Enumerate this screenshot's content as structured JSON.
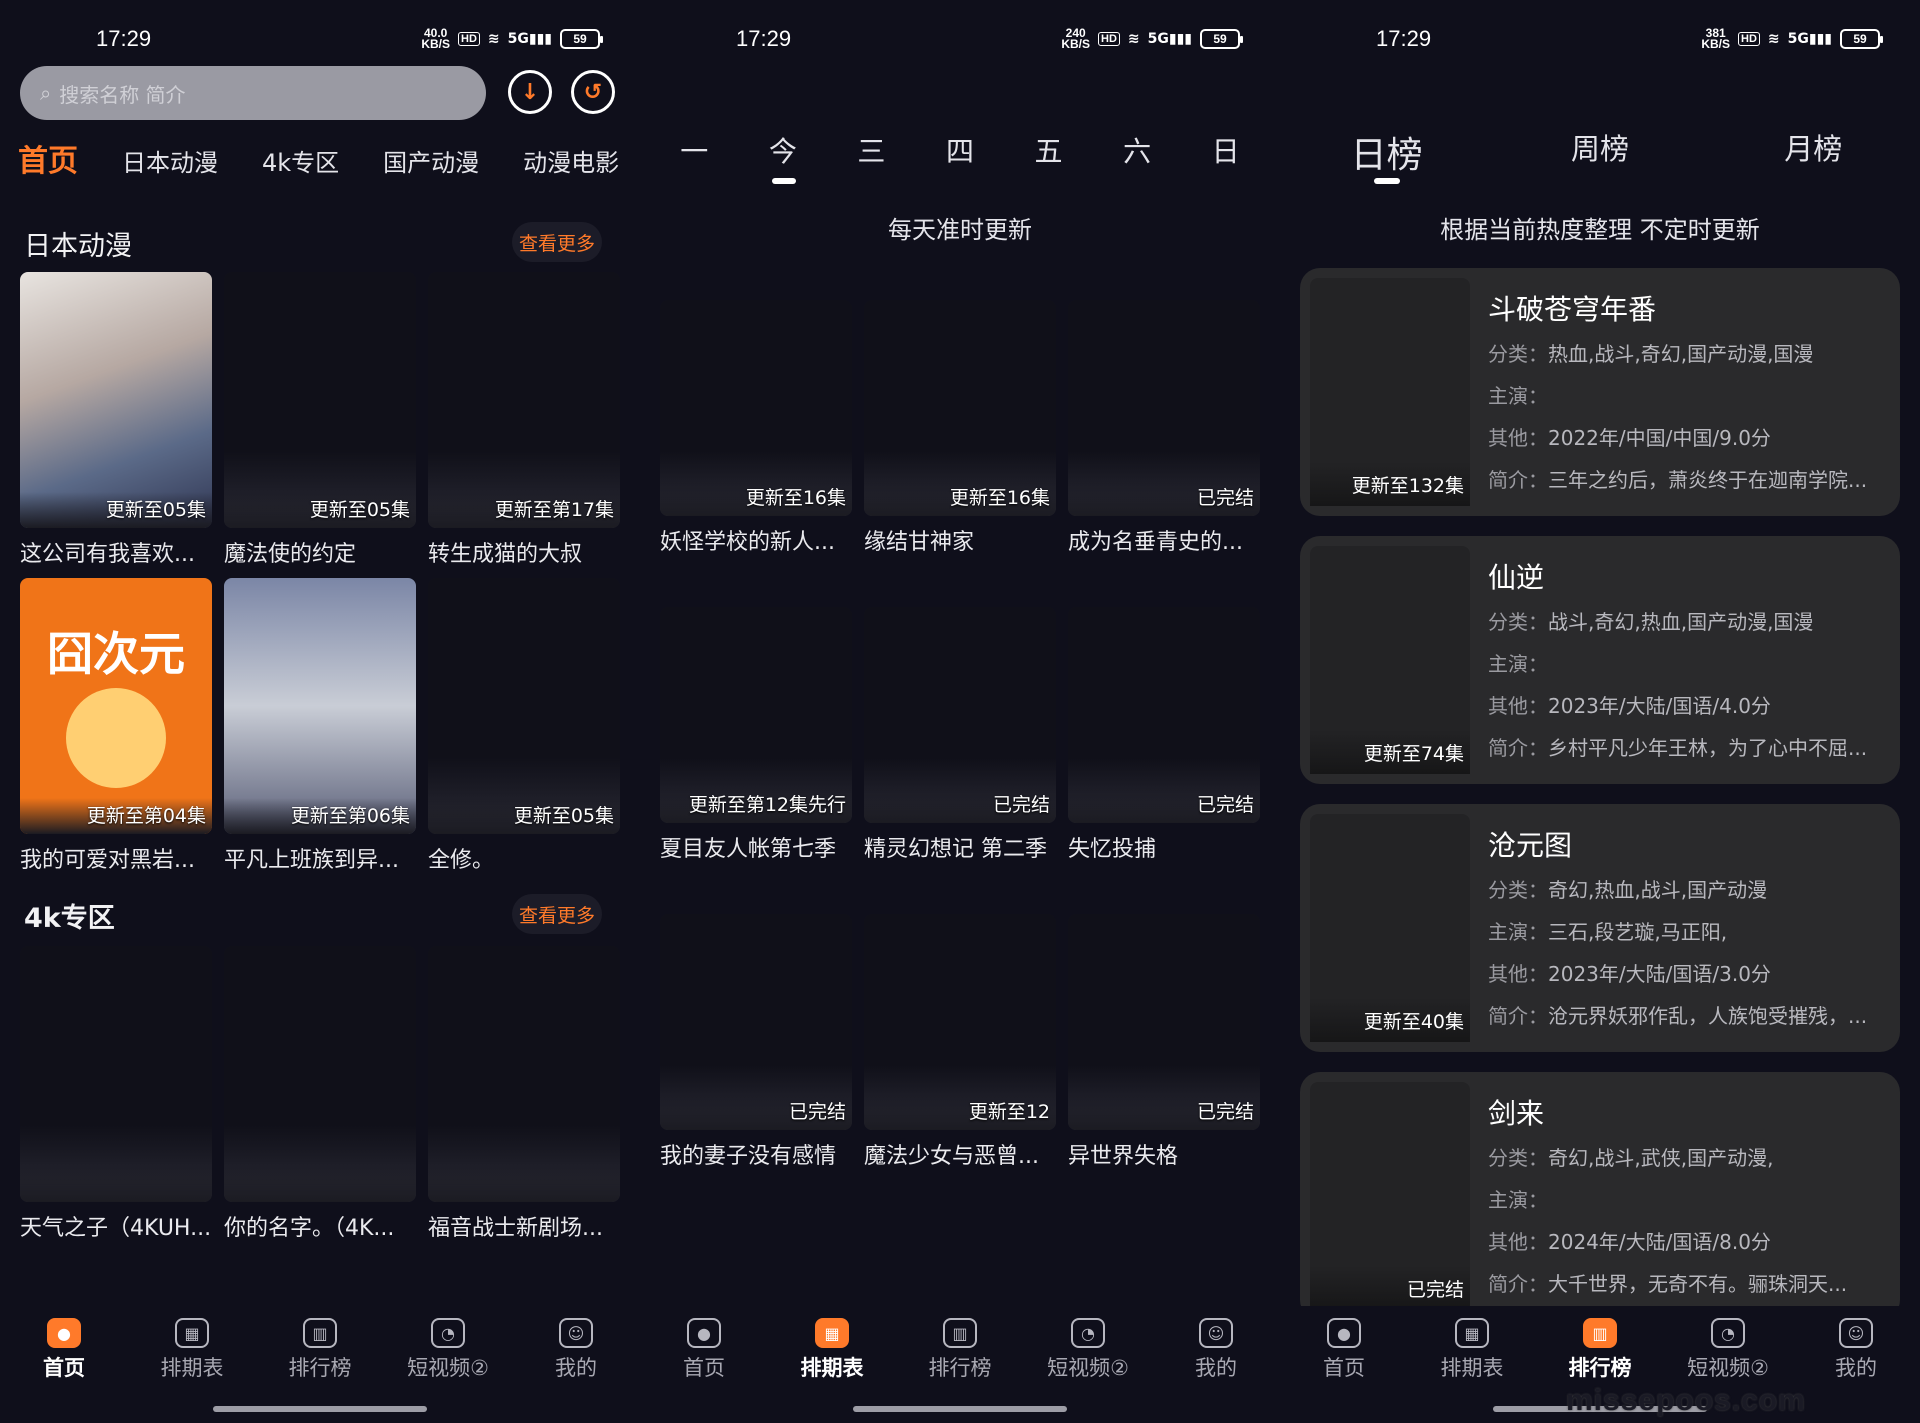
{
  "status": {
    "time": "17:29",
    "speeds": [
      "40.0",
      "240",
      "381"
    ],
    "speed_unit": "KB/S",
    "hd": "HD",
    "net": "5G",
    "battery": "59"
  },
  "home": {
    "search_placeholder": "搜索名称 简介",
    "tabs": [
      "首页",
      "日本动漫",
      "4k专区",
      "国产动漫",
      "动漫电影"
    ],
    "section1_title": "日本动漫",
    "section2_title": "4k专区",
    "more_label": "查看更多",
    "art_text": "囧次元",
    "jp_cards": [
      {
        "ep": "更新至05集",
        "title": "这公司有我喜欢..."
      },
      {
        "ep": "更新至05集",
        "title": "魔法使的约定"
      },
      {
        "ep": "更新至第17集",
        "title": "转生成猫的大叔"
      },
      {
        "ep": "更新至第04集",
        "title": "我的可爱对黑岩..."
      },
      {
        "ep": "更新至第06集",
        "title": "平凡上班族到异..."
      },
      {
        "ep": "更新至05集",
        "title": "全修。"
      }
    ],
    "k4_cards": [
      {
        "title": "天气之子（4KUH..."
      },
      {
        "title": "你的名字。（4K..."
      },
      {
        "title": "福音战士新剧场..."
      }
    ]
  },
  "schedule": {
    "days": [
      "一",
      "今",
      "三",
      "四",
      "五",
      "六",
      "日"
    ],
    "subtitle": "每天准时更新",
    "cards": [
      {
        "ep": "更新至16集",
        "title": "妖怪学校的新人..."
      },
      {
        "ep": "更新至16集",
        "title": "缘结甘神家"
      },
      {
        "ep": "已完结",
        "title": "成为名垂青史的..."
      },
      {
        "ep": "更新至第12集先行",
        "title": "夏目友人帐第七季"
      },
      {
        "ep": "已完结",
        "title": "精灵幻想记 第二季"
      },
      {
        "ep": "已完结",
        "title": "失忆投捕"
      },
      {
        "ep": "已完结",
        "title": "我的妻子没有感情"
      },
      {
        "ep": "更新至12",
        "title": "魔法少女与恶曾..."
      },
      {
        "ep": "已完结",
        "title": "异世界失格"
      }
    ]
  },
  "ranking": {
    "tabs": [
      "日榜",
      "周榜",
      "月榜"
    ],
    "subtitle": "根据当前热度整理 不定时更新",
    "labels": {
      "cat": "分类：",
      "cast": "主演：",
      "other": "其他：",
      "intro": "简介："
    },
    "items": [
      {
        "title": "斗破苍穹年番",
        "cat": "热血,战斗,奇幻,国产动漫,国漫",
        "cast": "",
        "other": "2022年/中国/中国/9.0分",
        "intro": "三年之约后，萧炎终于在迦南学院...",
        "ep": "更新至132集"
      },
      {
        "title": "仙逆",
        "cat": "战斗,奇幻,热血,国产动漫,国漫",
        "cast": "",
        "other": "2023年/大陆/国语/4.0分",
        "intro": "乡村平凡少年王林，为了心中不屈...",
        "ep": "更新至74集"
      },
      {
        "title": "沧元图",
        "cat": "奇幻,热血,战斗,国产动漫",
        "cast": "三石,段艺璇,马正阳,",
        "other": "2023年/大陆/国语/3.0分",
        "intro": "沧元界妖邪作乱，人族饱受摧残，...",
        "ep": "更新至40集"
      },
      {
        "title": "剑来",
        "cat": "奇幻,战斗,武侠,国产动漫,",
        "cast": "",
        "other": "2024年/大陆/国语/8.0分",
        "intro": "大千世界，无奇不有。骊珠洞天...",
        "ep": "已完结"
      }
    ]
  },
  "bottom_nav": [
    "首页",
    "排期表",
    "排行榜",
    "短视频②",
    "我的"
  ],
  "watermark": "missepoos.com"
}
